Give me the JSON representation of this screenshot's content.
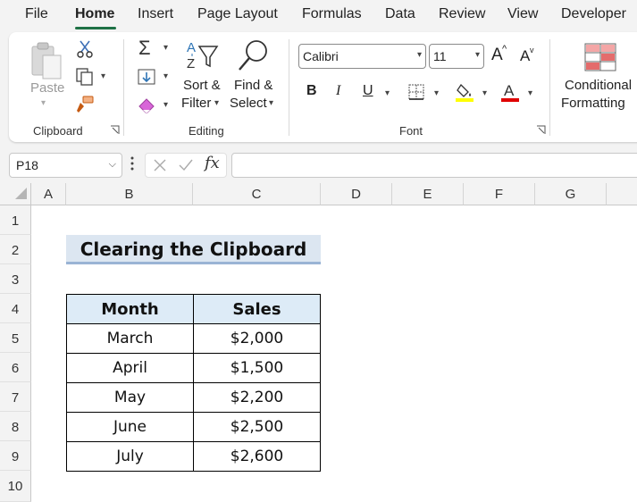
{
  "menu": {
    "tabs": [
      "File",
      "Home",
      "Insert",
      "Page Layout",
      "Formulas",
      "Data",
      "Review",
      "View",
      "Developer"
    ],
    "active": "Home"
  },
  "ribbon": {
    "clipboard": {
      "paste_label": "Paste",
      "group_label": "Clipboard"
    },
    "editing": {
      "sort_label_line1": "Sort &",
      "sort_label_line2": "Filter",
      "find_label_line1": "Find &",
      "find_label_line2": "Select",
      "group_label": "Editing"
    },
    "font": {
      "font_name": "Calibri",
      "font_size": "11",
      "grow_label": "A",
      "shrink_label": "A",
      "bold_label": "B",
      "italic_label": "I",
      "underline_label": "U",
      "font_color_label": "A",
      "group_label": "Font",
      "highlight_color": "#ffff00",
      "font_color": "#e00000"
    },
    "styles": {
      "conditional_line1": "Conditional",
      "conditional_line2": "Formatting"
    }
  },
  "formula_bar": {
    "name_box": "P18",
    "fx_label": "fx",
    "formula": ""
  },
  "grid": {
    "columns": [
      "A",
      "B",
      "C",
      "D",
      "E",
      "F",
      "G"
    ],
    "rows": [
      "1",
      "2",
      "3",
      "4",
      "5",
      "6",
      "7",
      "8",
      "9",
      "10"
    ]
  },
  "sheet": {
    "title": "Clearing the Clipboard",
    "headers": [
      "Month",
      "Sales"
    ],
    "rows": [
      [
        "March",
        "$2,000"
      ],
      [
        "April",
        "$1,500"
      ],
      [
        "May",
        "$2,200"
      ],
      [
        "June",
        "$2,500"
      ],
      [
        "July",
        "$2,600"
      ]
    ]
  },
  "colors": {
    "accent": "#1e7145",
    "title_fill": "#dce6f1",
    "header_fill": "#ddebf7"
  }
}
